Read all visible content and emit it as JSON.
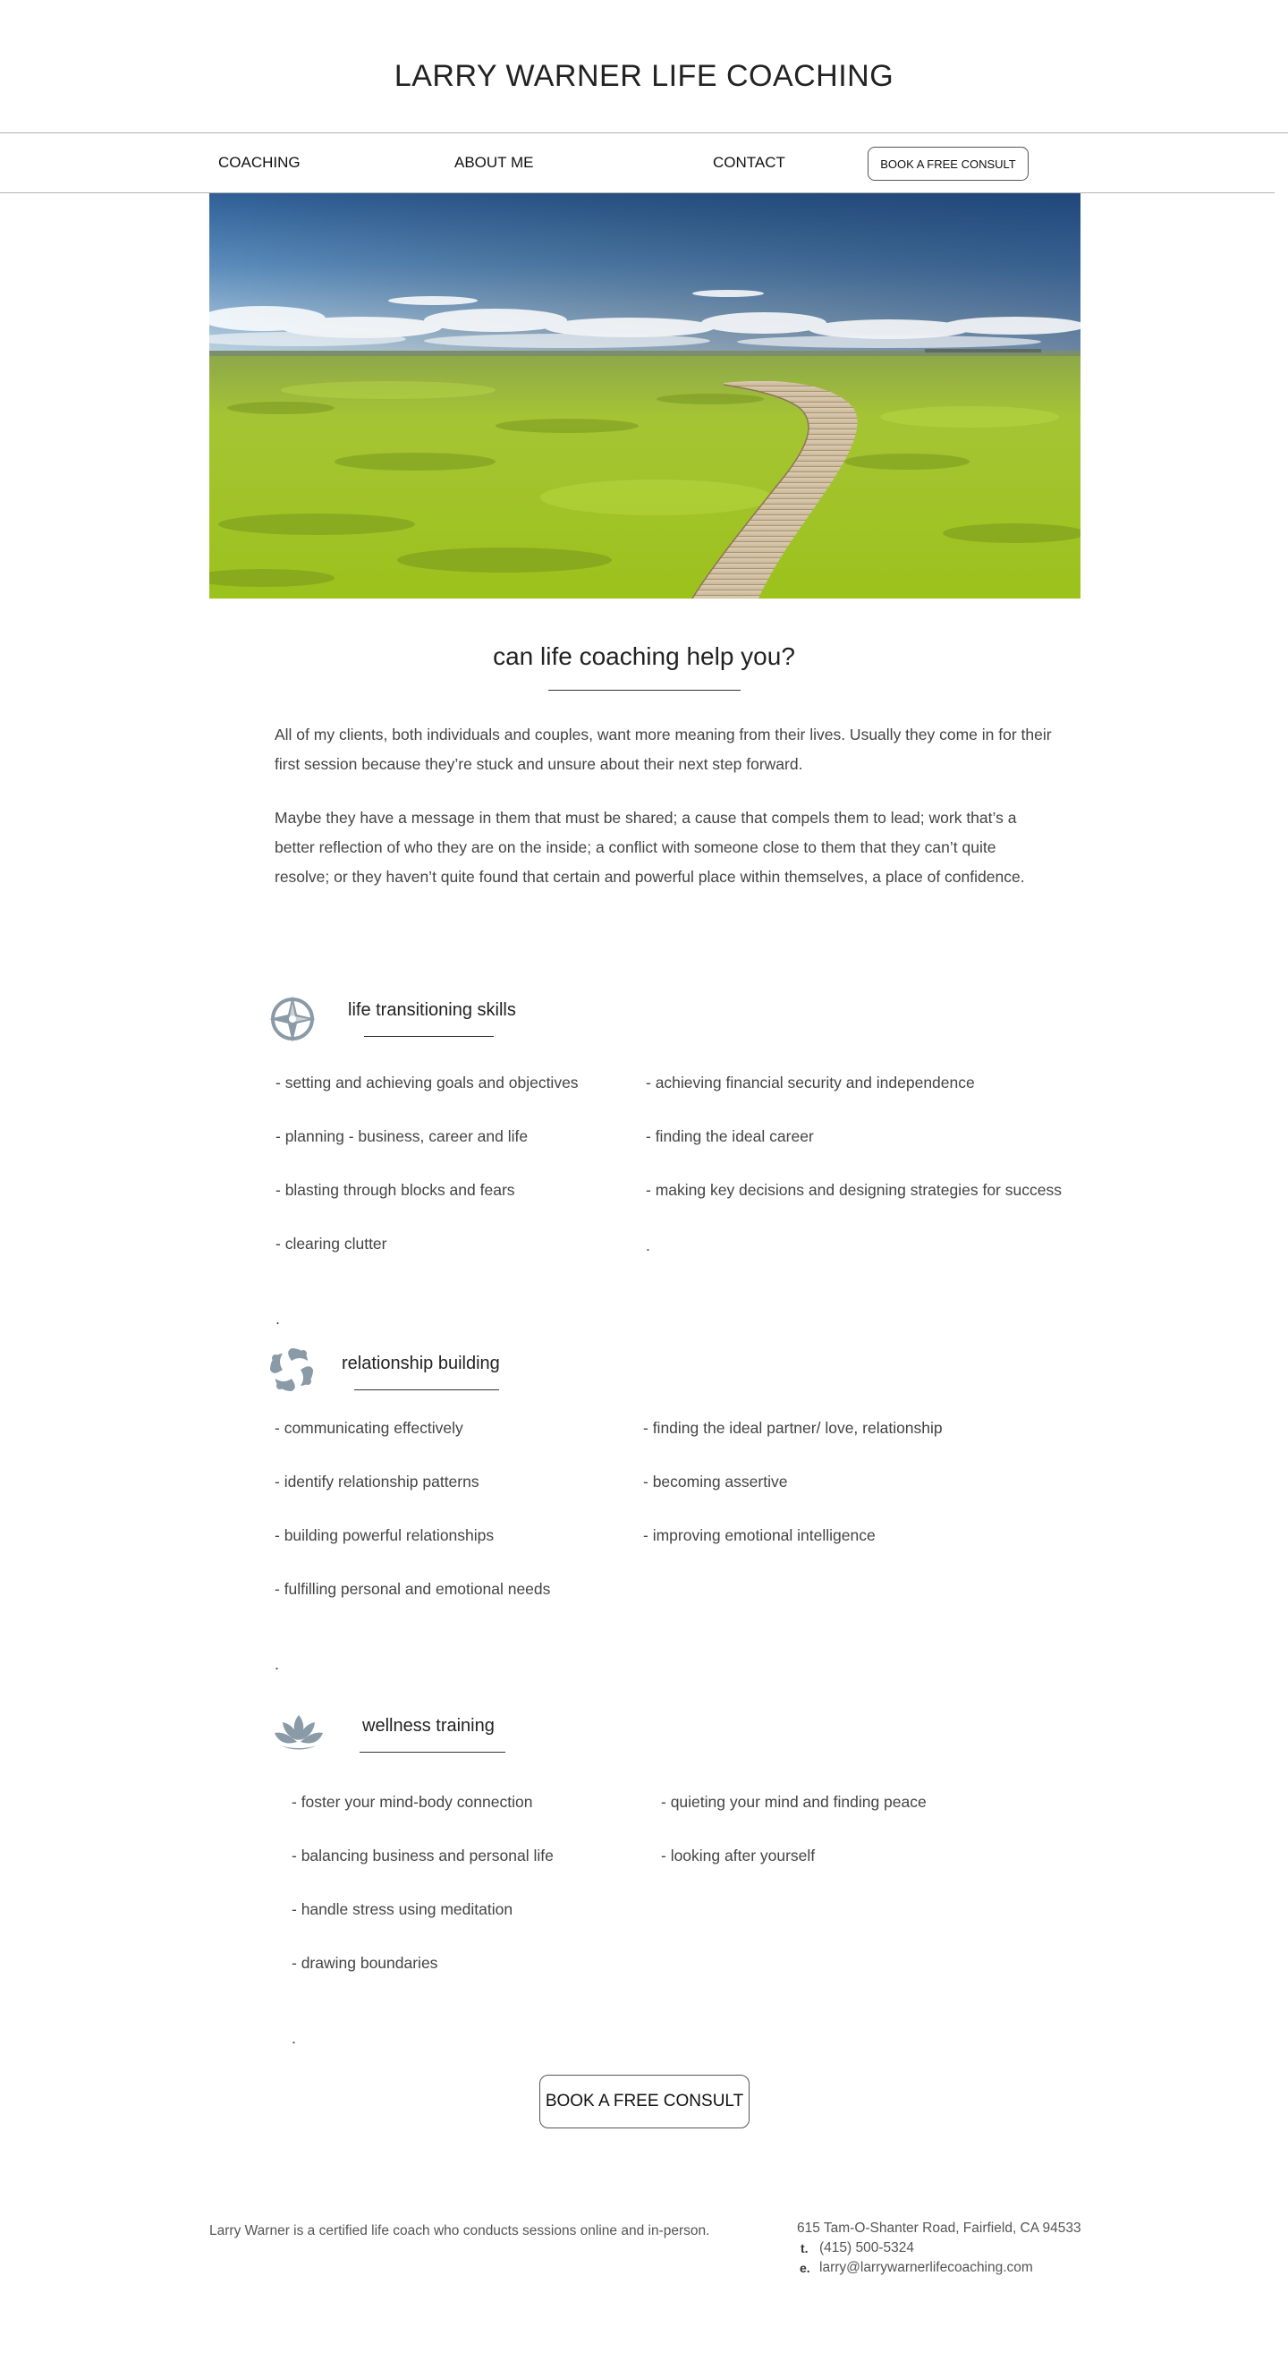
{
  "header": {
    "title": "LARRY WARNER LIFE COACHING"
  },
  "nav": {
    "coaching": "COACHING",
    "about": "ABOUT ME",
    "contact": "CONTACT",
    "cta": "BOOK A FREE CONSULT"
  },
  "intro": {
    "heading": "can life coaching help you?",
    "p1": "All of my clients, both individuals and couples, want more meaning from their lives. Usually they come in for their first session because they’re stuck and unsure about their next step forward.",
    "p2": "Maybe they have a message in them that must be shared; a cause that compels them to lead; work that’s a better reflection of who they are on the inside; a conflict with someone close to them that they can’t quite resolve; or they haven’t quite found that certain and powerful place within themselves, a place of confidence."
  },
  "sections": [
    {
      "icon": "compass-icon",
      "title": "life transitioning skills",
      "left": [
        "- setting and achieving goals and objectives",
        "- planning - business, career and life",
        "- blasting through blocks and fears",
        "- clearing clutter"
      ],
      "right": [
        "-  achieving financial security and independence",
        "- finding the ideal career",
        "- making key decisions and designing strategies for success",
        "."
      ],
      "trailing_dot": "."
    },
    {
      "icon": "circle-of-people-icon",
      "title": "relationship building",
      "left": [
        "- communicating effectively",
        "- identify relationship patterns",
        "- building powerful relationships",
        "- fulfilling personal and emotional needs"
      ],
      "right": [
        "-  finding the ideal partner/ love, relationship",
        "- becoming assertive",
        "- improving emotional intelligence"
      ],
      "trailing_dot": "."
    },
    {
      "icon": "lotus-icon",
      "title": "wellness training",
      "left": [
        "- foster your mind-body connection",
        "- balancing business and personal life",
        "- handle stress using meditation",
        "- drawing boundaries"
      ],
      "right": [
        "-  quieting your mind and finding peace",
        "- looking after yourself"
      ],
      "trailing_dot": "."
    }
  ],
  "cta": {
    "label": "BOOK A FREE CONSULT"
  },
  "footer": {
    "about": "Larry Warner is a certified life coach who conducts sessions online and in-person.",
    "address": "615 Tam-O-Shanter Road, Fairfield, CA 94533",
    "phone_label": "t.",
    "phone": "(415) 500-5324",
    "email_label": "e.",
    "email": "larry@larrywarnerlifecoaching.com"
  },
  "colors": {
    "icon": "#8a9aa6",
    "text": "#444444",
    "rule": "#333333"
  }
}
